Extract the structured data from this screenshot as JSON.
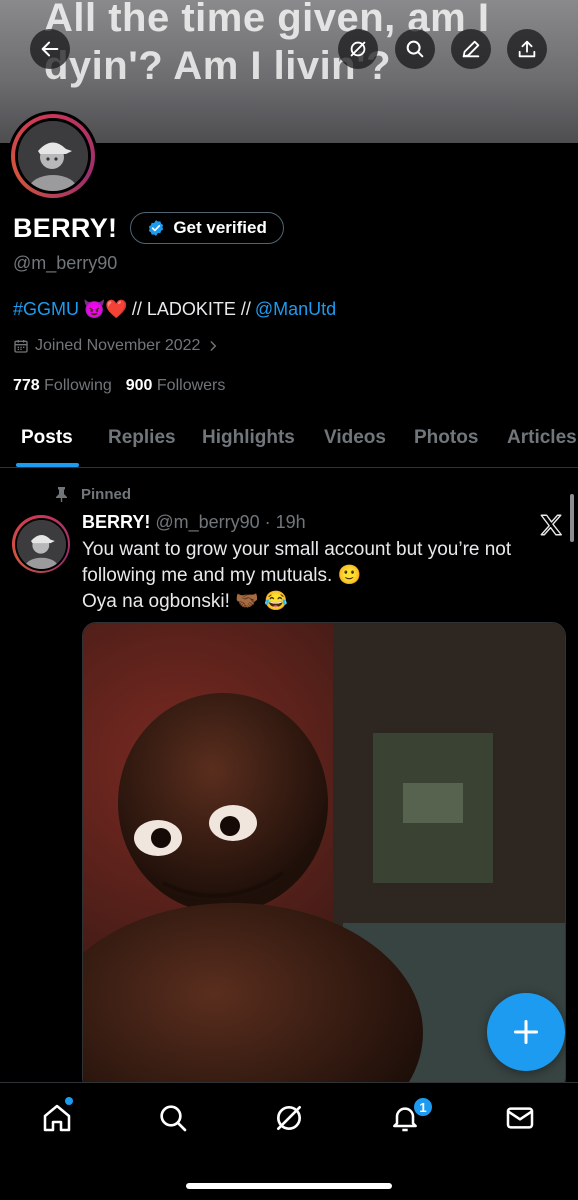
{
  "banner": {
    "text": "All the time given, am I dyin'? Am I livin'?"
  },
  "header": {
    "back_icon": "arrow-left-icon",
    "grok_icon": "grok-icon",
    "search_icon": "search-icon",
    "edit_icon": "pencil-icon",
    "share_icon": "share-icon"
  },
  "profile": {
    "display_name": "BERRY!",
    "verify_label": "Get verified",
    "handle": "@m_berry90",
    "bio": {
      "hashtag": "#GGMU",
      "emojis": "😈❤️",
      "text": "// LADOKITE //",
      "mention": "@ManUtd"
    },
    "joined": "Joined November 2022",
    "following_count": "778",
    "following_label": "Following",
    "followers_count": "900",
    "followers_label": "Followers"
  },
  "tabs": [
    "Posts",
    "Replies",
    "Highlights",
    "Videos",
    "Photos",
    "Articles"
  ],
  "active_tab": "Posts",
  "post": {
    "pinned_label": "Pinned",
    "author_name": "BERRY!",
    "meta": "@m_berry90 · 19h",
    "text_line1": "You want to grow your small account but you’re not following me and my mutuals. 🙂",
    "text_line2": "Oya na ogbonski! 🤝🏾 😂"
  },
  "bottom_nav": {
    "items": [
      "home-icon",
      "search-icon",
      "grok-icon",
      "notifications-icon",
      "messages-icon"
    ],
    "notification_count": "1"
  },
  "colors": {
    "accent": "#1d9bf0",
    "background": "#000000",
    "muted": "#71767b"
  }
}
